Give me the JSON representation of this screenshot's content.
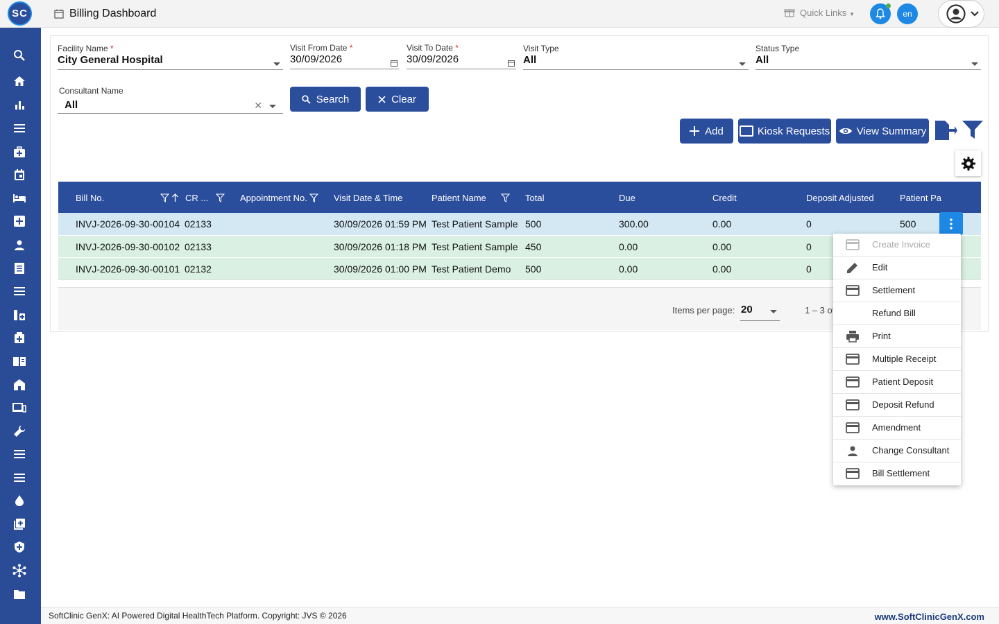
{
  "header": {
    "logo_text": "SC",
    "title": "Billing Dashboard",
    "quick_links": "Quick Links",
    "language": "en"
  },
  "sidebar": {
    "items": [
      {
        "icon": "search-icon"
      },
      {
        "icon": "home-icon"
      },
      {
        "icon": "bar-chart-icon"
      },
      {
        "icon": "menu-icon"
      },
      {
        "icon": "medical-bag-icon"
      },
      {
        "icon": "calendar-icon"
      },
      {
        "icon": "bed-icon"
      },
      {
        "icon": "hospital-plus-icon"
      },
      {
        "icon": "person-icon"
      },
      {
        "icon": "receipt-icon"
      },
      {
        "icon": "list-icon"
      },
      {
        "icon": "pharmacy-icon"
      },
      {
        "icon": "medical-kit-icon"
      },
      {
        "icon": "book-icon"
      },
      {
        "icon": "store-icon"
      },
      {
        "icon": "devices-icon"
      },
      {
        "icon": "wrench-icon"
      },
      {
        "icon": "list-icon"
      },
      {
        "icon": "list-icon"
      },
      {
        "icon": "blood-drop-icon"
      },
      {
        "icon": "add-box-icon"
      },
      {
        "icon": "shield-icon"
      },
      {
        "icon": "network-icon"
      },
      {
        "icon": "folder-icon"
      }
    ]
  },
  "filters": {
    "facility": {
      "label": "Facility Name",
      "value": "City General Hospital"
    },
    "visit_from": {
      "label": "Visit From Date",
      "value": "30/09/2026"
    },
    "visit_to": {
      "label": "Visit To Date",
      "value": "30/09/2026"
    },
    "visit_type": {
      "label": "Visit Type",
      "value": "All"
    },
    "status_type": {
      "label": "Status Type",
      "value": "All"
    },
    "consultant": {
      "label": "Consultant Name",
      "value": "All"
    },
    "required_mark": "*"
  },
  "buttons": {
    "search": "Search",
    "clear": "Clear",
    "add": "Add",
    "kiosk": "Kiosk Requests",
    "view_summary": "View Summary"
  },
  "table": {
    "columns": [
      "Bill No.",
      "CR ...",
      "Appointment No.",
      "Visit Date & Time",
      "Patient Name",
      "Total",
      "Due",
      "Credit",
      "Deposit Adjusted",
      "Patient Pa"
    ],
    "rows": [
      {
        "bill": "INVJ-2026-09-30-00104",
        "cr": "02133",
        "appt": "",
        "date": "30/09/2026 01:59 PM",
        "patient": "Test Patient Sample",
        "total": "500",
        "due": "300.00",
        "credit": "0.00",
        "deposit": "0",
        "paid": "500"
      },
      {
        "bill": "INVJ-2026-09-30-00102",
        "cr": "02133",
        "appt": "",
        "date": "30/09/2026 01:18 PM",
        "patient": "Test Patient Sample",
        "total": "450",
        "due": "0.00",
        "credit": "0.00",
        "deposit": "0",
        "paid": ""
      },
      {
        "bill": "INVJ-2026-09-30-00101",
        "cr": "02132",
        "appt": "",
        "date": "30/09/2026 01:00 PM",
        "patient": "Test Patient Demo",
        "total": "500",
        "due": "0.00",
        "credit": "0.00",
        "deposit": "0",
        "paid": ""
      }
    ]
  },
  "pager": {
    "items_per_page_label": "Items per page:",
    "items_per_page": "20",
    "range": "1 – 3 of"
  },
  "menu": {
    "items": [
      {
        "label": "Create Invoice",
        "icon": "card-icon",
        "disabled": true
      },
      {
        "label": "Edit",
        "icon": "pencil-icon"
      },
      {
        "label": "Settlement",
        "icon": "card-icon"
      },
      {
        "label": "Refund Bill",
        "icon": ""
      },
      {
        "label": "Print",
        "icon": "printer-icon"
      },
      {
        "label": "Multiple Receipt",
        "icon": "card-icon"
      },
      {
        "label": "Patient Deposit",
        "icon": "card-icon"
      },
      {
        "label": "Deposit Refund",
        "icon": "card-icon"
      },
      {
        "label": "Amendment",
        "icon": "card-icon"
      },
      {
        "label": "Change Consultant",
        "icon": "person-icon"
      },
      {
        "label": "Bill Settlement",
        "icon": "card-icon"
      }
    ]
  },
  "footer": {
    "text": "SoftClinic GenX: AI Powered Digital HealthTech Platform. Copyright: JVS © 2026",
    "link": "www.SoftClinicGenX.com"
  },
  "colors": {
    "primary": "#2a4d9c",
    "accent": "#1e88e5",
    "selected_row": "#d3e8f3",
    "paid_row": "#daf0e2"
  }
}
